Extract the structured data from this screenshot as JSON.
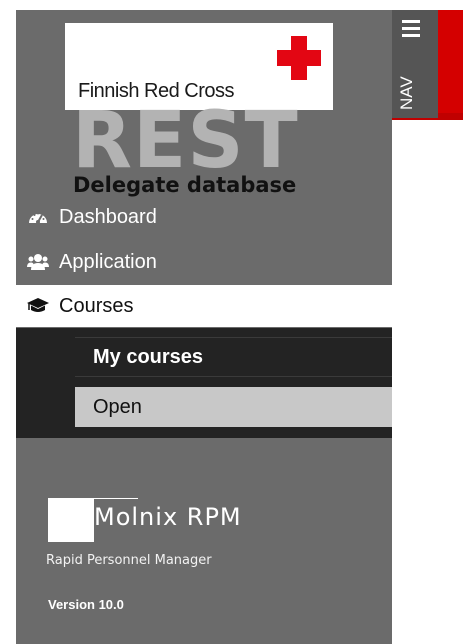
{
  "brand": {
    "org_name": "Finnish Red Cross",
    "app_word": "REST",
    "app_subtitle": "Delegate database"
  },
  "menu": {
    "items": [
      {
        "label": "Dashboard",
        "icon": "dashboard-gauge-icon"
      },
      {
        "label": "Application",
        "icon": "users-icon"
      },
      {
        "label": "Courses",
        "icon": "graduation-cap-icon",
        "active": true
      }
    ],
    "submenu": {
      "heading": "My courses",
      "items": [
        {
          "label": "Open",
          "selected": true
        }
      ]
    }
  },
  "footer": {
    "vendor_name": "Molnix RPM",
    "tagline": "Rapid Personnel Manager",
    "version": "Version 10.0"
  },
  "nav_toggle": {
    "label": "NAV",
    "icon": "hamburger-menu-icon"
  },
  "colors": {
    "sidebar_bg": "#6b6b6b",
    "submenu_bg": "#232323",
    "accent_red": "#d40000",
    "active_item_bg": "#ffffff"
  }
}
